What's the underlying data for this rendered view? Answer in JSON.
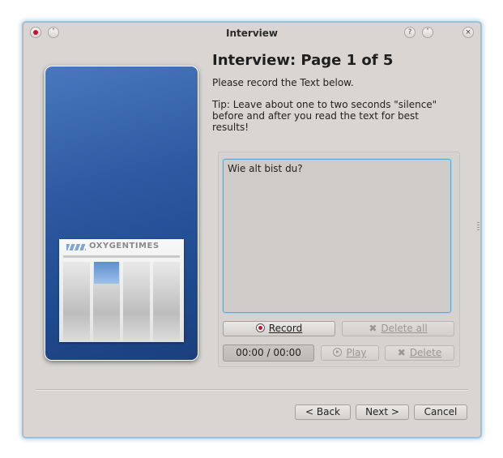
{
  "window": {
    "title": "Interview",
    "controls": [
      "close-dot-icon",
      "keep-above-icon",
      "help-icon",
      "minimize-icon",
      "close-icon"
    ]
  },
  "sidepanel": {
    "logo_text": "OXYGENTIMES"
  },
  "page": {
    "heading": "Interview: Page 1 of 5",
    "instruction": "Please record the Text below.",
    "tip": "Tip: Leave about one to two seconds \"silence\" before and after you read the text for best results!"
  },
  "prompt": {
    "text": "Wie alt bist du?"
  },
  "controls": {
    "record_label": "Record",
    "delete_all_label": "Delete all",
    "time_display": "00:00 / 00:00",
    "play_label": "Play",
    "delete_label": "Delete"
  },
  "footer": {
    "back_label": "< Back",
    "next_label": "Next >",
    "cancel_label": "Cancel"
  },
  "colors": {
    "accent_focus": "#5aa7d6",
    "record_red": "#c8102e",
    "panel_blue": "#2d5aa2"
  }
}
